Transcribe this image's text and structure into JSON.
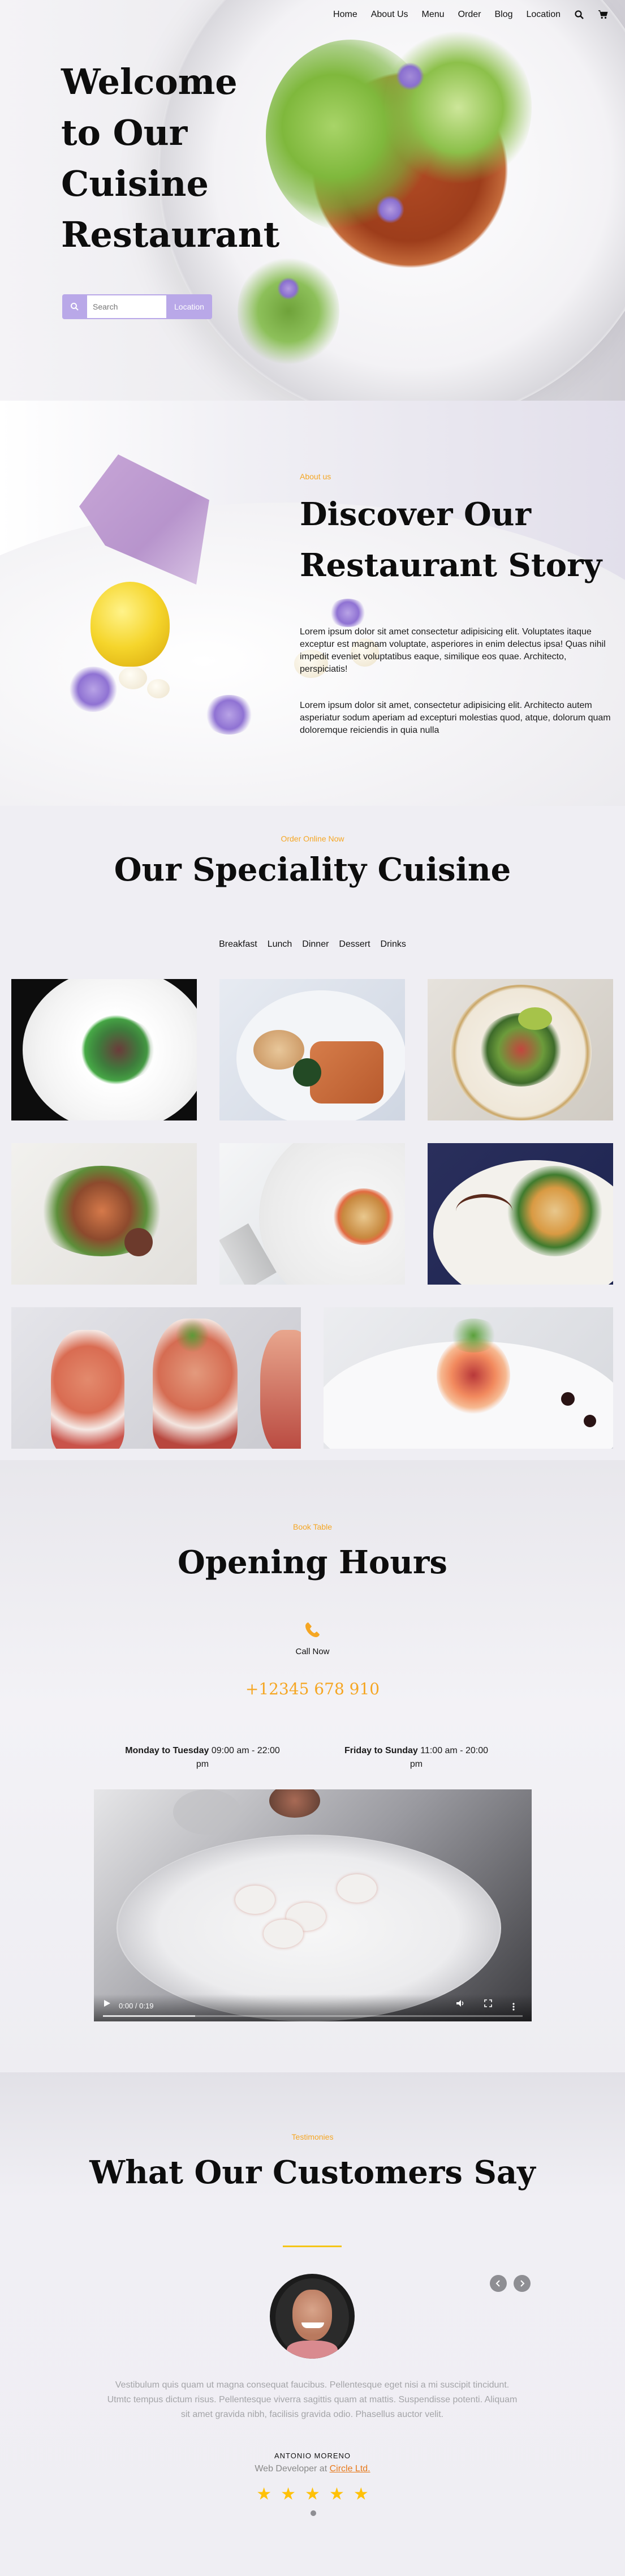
{
  "nav": {
    "items": [
      "Home",
      "About Us",
      "Menu",
      "Order",
      "Blog",
      "Location"
    ],
    "search_icon": "search-icon",
    "cart_icon": "cart-icon"
  },
  "hero": {
    "title": "Welcome to Our Cuisine Restaurant",
    "search_placeholder": "Search",
    "location_label": "Location"
  },
  "about": {
    "eyebrow": "About us",
    "title": "Discover Our Restaurant Story",
    "para1": "Lorem ipsum dolor sit amet consectetur adipisicing elit. Voluptates itaque exceptur est magnam voluptate, asperiores in enim delectus ipsa! Quas nihil impedit eveniet voluptatibus eaque, similique eos quae. Architecto, perspiciatis!",
    "para2": "Lorem ipsum dolor sit amet, consectetur adipisicing elit. Architecto autem asperiatur sodum aperiam ad excepturi molestias quod, atque, dolorum quam doloremque reiciendis in quia nulla"
  },
  "speciality": {
    "eyebrow": "Order Online Now",
    "title": "Our Speciality Cuisine",
    "tabs": [
      "Breakfast",
      "Lunch",
      "Dinner",
      "Dessert",
      "Drinks"
    ]
  },
  "hours": {
    "eyebrow": "Book Table",
    "title": "Opening Hours",
    "phone_icon": "phone-icon",
    "call_now": "Call Now",
    "phone": "+12345 678 910",
    "mon_tue_label": "Monday to Tuesday",
    "mon_tue_time": "09:00 am - 22:00 pm",
    "fri_sun_label": "Friday to Sunday",
    "fri_sun_time": "11:00 am - 20:00 pm",
    "video_time": "0:00 / 0:19"
  },
  "testimonials": {
    "eyebrow": "Testimonies",
    "title": "What Our Customers Say",
    "quote": "Vestibulum quis quam ut magna consequat faucibus. Pellentesque eget nisi a mi suscipit tincidunt. Utmtc tempus dictum risus. Pellentesque viverra sagittis quam at mattis. Suspendisse potenti. Aliquam sit amet gravida nibh, facilisis gravida odio. Phasellus auctor velit.",
    "name": "ANTONIO MORENO",
    "role_prefix": "Web Developer at",
    "company": "Circle Ltd.",
    "rating": 5
  },
  "colors": {
    "accent_orange": "#f5a623",
    "accent_lavender": "#b9a8e8",
    "link_orange": "#e7791b",
    "star": "#ffc107"
  }
}
